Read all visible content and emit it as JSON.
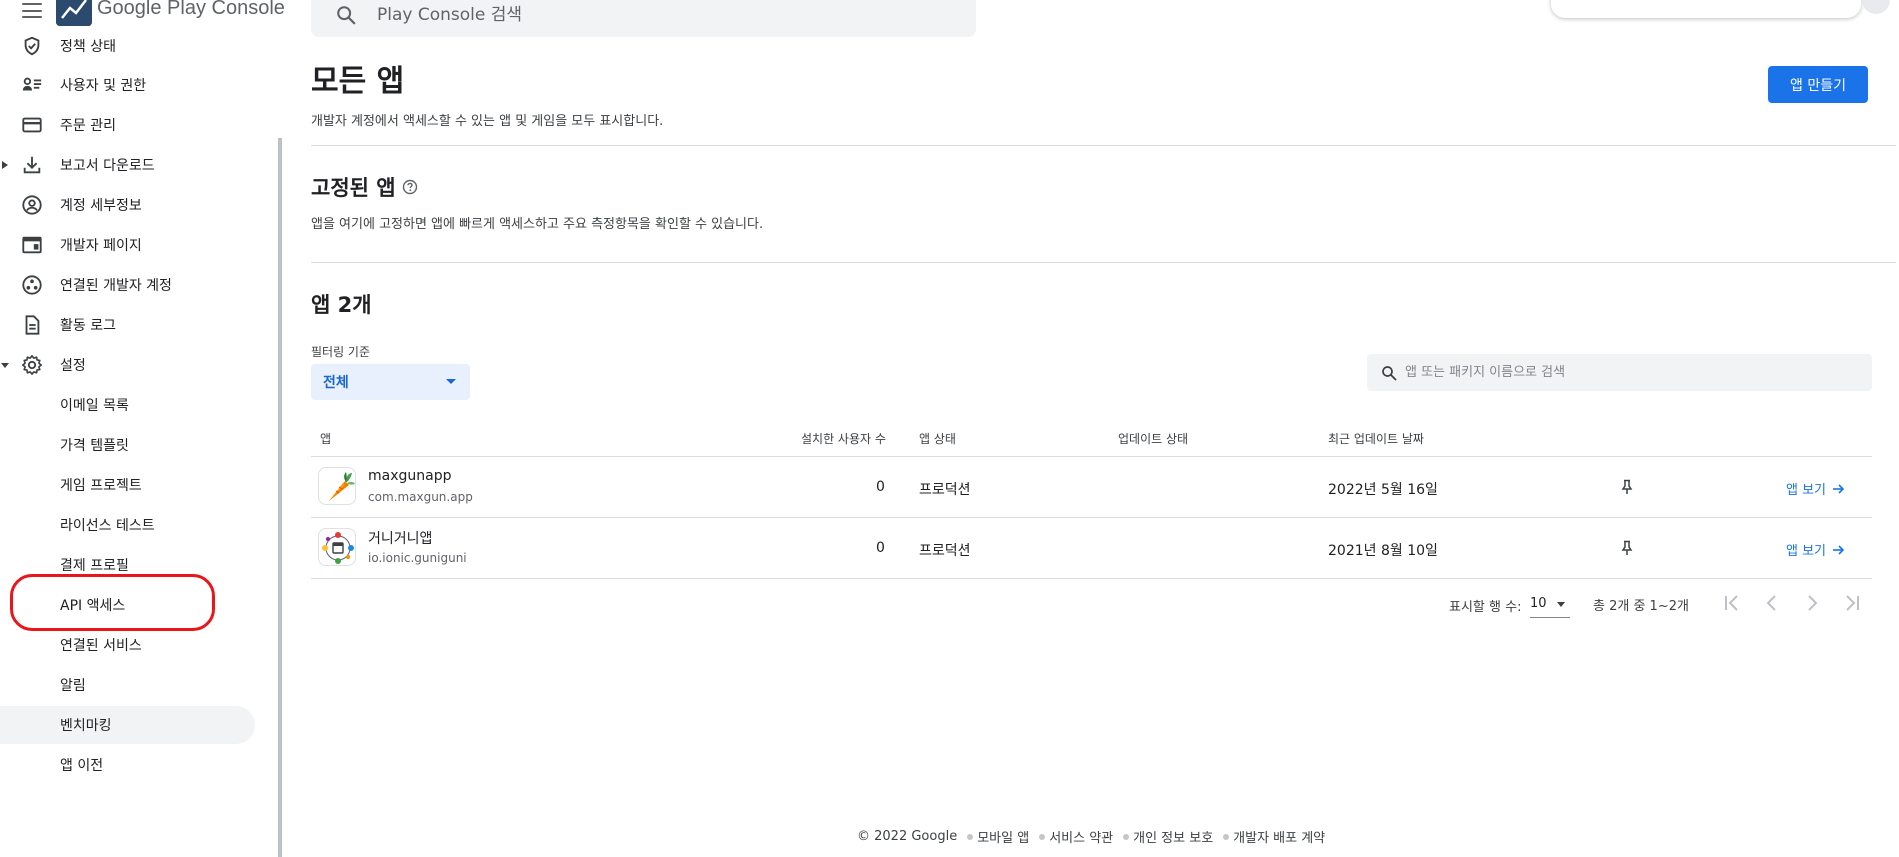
{
  "topbar": {
    "brand": "Google Play Console",
    "search_placeholder": "Play Console 검색"
  },
  "sidebar": {
    "items": [
      {
        "label": "정책 상태",
        "icon": "shield-check-icon"
      },
      {
        "label": "사용자 및 권한",
        "icon": "people-list-icon"
      },
      {
        "label": "주문 관리",
        "icon": "credit-card-icon"
      },
      {
        "label": "보고서 다운로드",
        "icon": "download-icon",
        "expandable": true
      },
      {
        "label": "계정 세부정보",
        "icon": "account-circle-icon"
      },
      {
        "label": "개발자 페이지",
        "icon": "web-page-icon"
      },
      {
        "label": "연결된 개발자 계정",
        "icon": "linked-accounts-icon"
      },
      {
        "label": "활동 로그",
        "icon": "document-icon"
      },
      {
        "label": "설정",
        "icon": "gear-icon",
        "expanded": true
      }
    ],
    "settings_sub": [
      {
        "label": "이메일 목록"
      },
      {
        "label": "가격 템플릿"
      },
      {
        "label": "게임 프로젝트"
      },
      {
        "label": "라이선스 테스트"
      },
      {
        "label": "결제 프로필"
      },
      {
        "label": "API 액세스"
      },
      {
        "label": "연결된 서비스"
      },
      {
        "label": "알림"
      },
      {
        "label": "벤치마킹",
        "active": true
      },
      {
        "label": "앱 이전"
      }
    ]
  },
  "main": {
    "title": "모든 앱",
    "subtitle": "개발자 계정에서 액세스할 수 있는 앱 및 게임을 모두 표시합니다.",
    "create_button": "앱 만들기",
    "pinned": {
      "title": "고정된 앱",
      "desc": "앱을 여기에 고정하면 앱에 빠르게 액세스하고 주요 측정항목을 확인할 수 있습니다."
    },
    "apps_section": {
      "title": "앱 2개",
      "filter_label": "필터링 기준",
      "filter_value": "전체",
      "search_placeholder": "앱 또는 패키지 이름으로 검색"
    },
    "table": {
      "headers": {
        "app": "앱",
        "installs": "설치한 사용자 수",
        "app_status": "앱 상태",
        "update_status": "업데이트 상태",
        "last_updated": "최근 업데이트 날짜"
      },
      "rows": [
        {
          "name": "maxgunapp",
          "package": "com.maxgun.app",
          "installs": "0",
          "status": "프로덕션",
          "update_status": "",
          "last_updated": "2022년 5월 16일",
          "view": "앱 보기",
          "icon": "carrot-icon"
        },
        {
          "name": "거니거니앱",
          "package": "io.ionic.guniguni",
          "installs": "0",
          "status": "프로덕션",
          "update_status": "",
          "last_updated": "2021년 8월 10일",
          "view": "앱 보기",
          "icon": "network-app-icon"
        }
      ]
    },
    "pagination": {
      "rows_label": "표시할 행 수:",
      "rows_value": "10",
      "range": "총 2개 중 1~2개"
    }
  },
  "footer": {
    "copyright": "© 2022 Google",
    "links": [
      "모바일 앱",
      "서비스 약관",
      "개인 정보 보호",
      "개발자 배포 계약"
    ]
  },
  "colors": {
    "accent": "#1a73e8",
    "highlight_ring": "#e8151b",
    "filter_bg": "#e8f0fe"
  }
}
